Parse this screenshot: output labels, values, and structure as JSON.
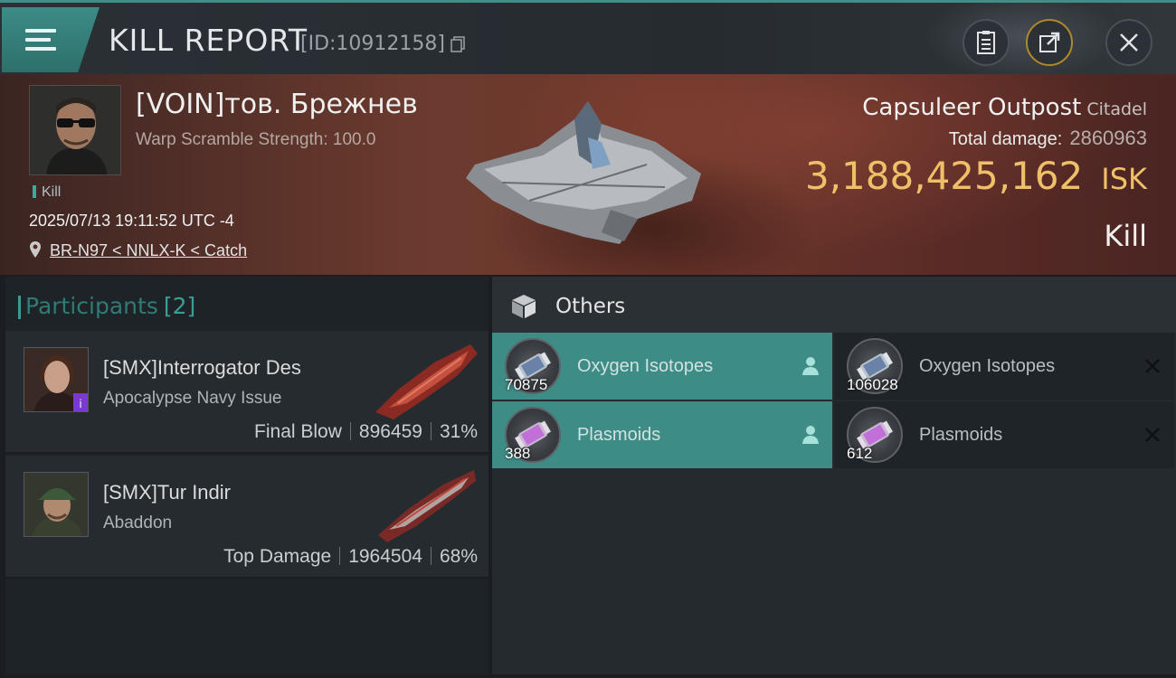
{
  "header": {
    "title": "KILL REPORT",
    "id_text": "[ID:10912158]",
    "icons": [
      "menu-icon",
      "copy-icon",
      "clipboard-icon",
      "share-icon",
      "close-icon"
    ]
  },
  "victim": {
    "name": "[VOIN]тов. Брежнев",
    "subtitle": "Warp Scramble Strength: 100.0",
    "tag": "Kill",
    "datetime": "2025/07/13 19:11:52 UTC -4",
    "location": "BR-N97 < NNLX-K < Catch",
    "structure_name": "Capsuleer Outpost",
    "structure_class": "Citadel",
    "total_damage_label": "Total damage:",
    "total_damage": "2860963",
    "isk_value": "3,188,425,162",
    "isk_unit": "ISK",
    "kind": "Kill"
  },
  "participants": {
    "title": "Participants",
    "count": "[2]",
    "rows": [
      {
        "name": "[SMX]Interrogator Des",
        "ship": "Apocalypse Navy Issue",
        "role": "Final Blow",
        "damage": "896459",
        "percent": "31%"
      },
      {
        "name": "[SMX]Tur Indir",
        "ship": "Abaddon",
        "role": "Top Damage",
        "damage": "1964504",
        "percent": "68%"
      }
    ]
  },
  "others": {
    "title": "Others",
    "items": [
      {
        "name": "Oxygen Isotopes",
        "qty": "70875",
        "status": "dropped"
      },
      {
        "name": "Oxygen Isotopes",
        "qty": "106028",
        "status": "destroyed"
      },
      {
        "name": "Plasmoids",
        "qty": "388",
        "status": "dropped"
      },
      {
        "name": "Plasmoids",
        "qty": "612",
        "status": "destroyed"
      }
    ]
  },
  "colors": {
    "accent_teal": "#3e8c86",
    "isk_gold": "#f0c068",
    "banner_red": "#6b3a2e"
  }
}
